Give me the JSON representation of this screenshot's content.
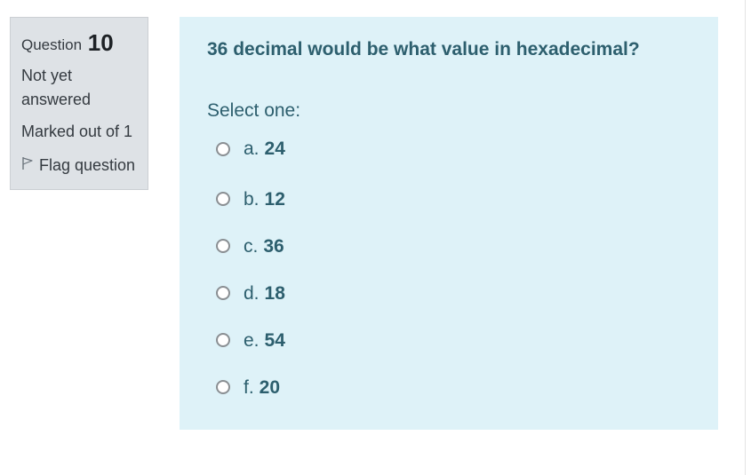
{
  "info": {
    "question_label": "Question",
    "question_number": "10",
    "state": "Not yet answered",
    "grade": "Marked out of 1",
    "flag_label": "Flag question"
  },
  "question": {
    "text": "36 decimal would be what value in hexadecimal?",
    "prompt": "Select one:",
    "options": [
      {
        "letter": "a.",
        "value": "24"
      },
      {
        "letter": "b.",
        "value": "12"
      },
      {
        "letter": "c.",
        "value": "36"
      },
      {
        "letter": "d.",
        "value": "18"
      },
      {
        "letter": "e.",
        "value": "54"
      },
      {
        "letter": "f.",
        "value": "20"
      }
    ]
  },
  "icons": {
    "flag": "flag-icon"
  },
  "colors": {
    "info_bg": "#dee2e6",
    "content_bg": "#def2f8",
    "text_accent": "#2d5f6e"
  }
}
